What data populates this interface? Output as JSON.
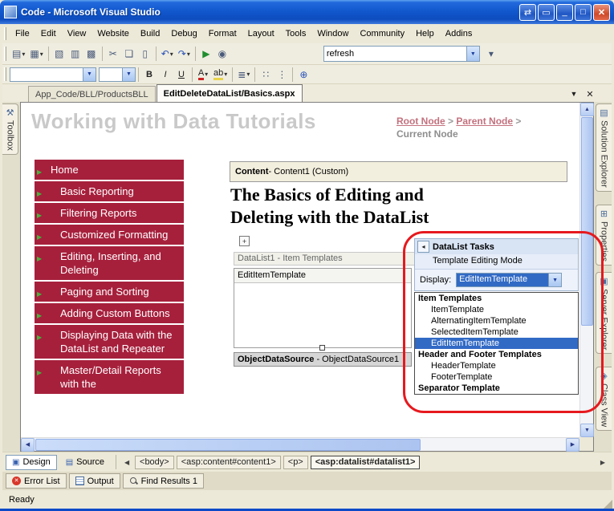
{
  "window": {
    "title": "Code - Microsoft Visual Studio",
    "status": "Ready"
  },
  "colors": {
    "selection_blue": "#316AC5",
    "nav_red": "#A6203C",
    "annotation_red": "#E6191E",
    "title_blue": "#0F55CF"
  },
  "icons": {
    "app": "▣",
    "switch": "⇄",
    "popout": "▭",
    "minimize": "_",
    "maximize": "□",
    "close": "✕",
    "dropdown": "▾",
    "new_project": "▤",
    "add_item": "▦",
    "open_file": "▧",
    "save": "▥",
    "save_all": "▩",
    "cut": "✂",
    "copy": "❏",
    "paste": "▯",
    "undo": "↶",
    "redo": "↷",
    "start_debug": "▶",
    "browse": "◉",
    "bold": "B",
    "italic": "I",
    "underline": "U",
    "font_color": "A",
    "highlight": "ab",
    "align": "≣",
    "bullets": "∷",
    "numbering": "⋮",
    "hyperlink": "⊕",
    "tab_list": "▼",
    "toolbox": "⚒",
    "solution_explorer": "▤",
    "properties": "⊞",
    "server_explorer": "▣",
    "class_view": "◈",
    "move": "+",
    "combo_arrow": "▼",
    "smart_tag_arrow": "◂",
    "nav_arrow": "▶",
    "up": "▲",
    "down": "▼",
    "left": "◀",
    "right": "▶",
    "design": "▣",
    "source": "▤"
  },
  "menu": {
    "items": [
      "File",
      "Edit",
      "View",
      "Website",
      "Build",
      "Debug",
      "Format",
      "Layout",
      "Tools",
      "Window",
      "Community",
      "Help",
      "Addins"
    ]
  },
  "toolbar": {
    "search_value": "refresh"
  },
  "doc_tabs": [
    {
      "label": "App_Code/BLL/ProductsBLL"
    },
    {
      "label": "EditDeleteDataList/Basics.aspx"
    }
  ],
  "left_strip": {
    "toolbox_label": "Toolbox"
  },
  "right_strip": {
    "tabs": [
      "Solution Explorer",
      "Properties",
      "Server Explorer",
      "Class View"
    ]
  },
  "designer": {
    "page_title": "Working with Data Tutorials",
    "breadcrumb": {
      "root": "Root Node",
      "sep1": ">",
      "parent": "Parent Node",
      "sep2": ">",
      "current": "Current Node"
    },
    "nav_items": [
      "Home",
      "Basic Reporting",
      "Filtering Reports",
      "Customized Formatting",
      "Editing, Inserting, and Deleting",
      "Paging and Sorting",
      "Adding Custom Buttons",
      "Displaying Data with the DataList and Repeater",
      "Master/Detail Reports with the"
    ],
    "content_header": {
      "bold": "Content",
      "rest": " - Content1 (Custom)"
    },
    "article_title_line1": "The Basics of Editing and",
    "article_title_line2": "Deleting with the DataList",
    "datalist_header": "DataList1 - Item Templates",
    "edit_item_template": "EditItemTemplate",
    "ods": {
      "bold": "ObjectDataSource",
      "rest": " - ObjectDataSource1"
    }
  },
  "smart_tag": {
    "title": "DataList Tasks",
    "subtitle": "Template Editing Mode",
    "display_label": "Display:",
    "display_value": "EditItemTemplate",
    "dropdown_items": [
      {
        "label": "Item Templates",
        "type": "header"
      },
      {
        "label": "ItemTemplate",
        "type": "item"
      },
      {
        "label": "AlternatingItemTemplate",
        "type": "item"
      },
      {
        "label": "SelectedItemTemplate",
        "type": "item"
      },
      {
        "label": "EditItemTemplate",
        "type": "item",
        "selected": true
      },
      {
        "label": "Header and Footer Templates",
        "type": "header"
      },
      {
        "label": "HeaderTemplate",
        "type": "item"
      },
      {
        "label": "FooterTemplate",
        "type": "item"
      },
      {
        "label": "Separator Template",
        "type": "header"
      }
    ]
  },
  "tag_bar": {
    "design": "Design",
    "source": "Source",
    "tags": [
      "<body>",
      "<asp:content#content1>",
      "<p>",
      "<asp:datalist#datalist1>"
    ]
  },
  "panel_tabs": [
    "Error List",
    "Output",
    "Find Results 1"
  ]
}
